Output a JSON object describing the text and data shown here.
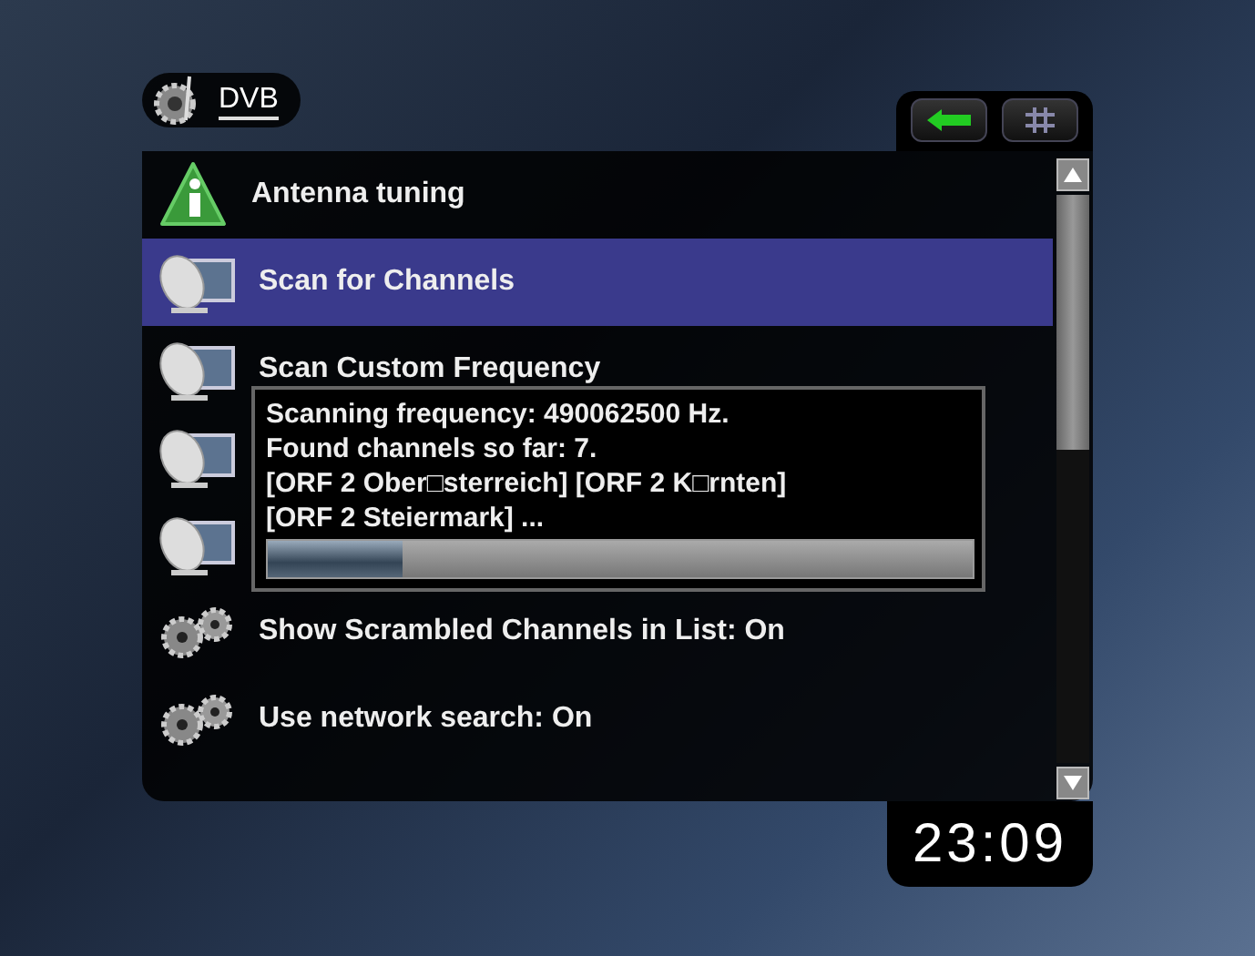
{
  "header": {
    "title": "DVB"
  },
  "menu": {
    "items": [
      {
        "kind": "info",
        "label": "Antenna tuning",
        "selected": false
      },
      {
        "kind": "dish",
        "label": "Scan for Channels",
        "selected": true
      },
      {
        "kind": "dish",
        "label": "Scan Custom Frequency",
        "selected": false
      },
      {
        "kind": "dish",
        "selected": false
      },
      {
        "kind": "dish",
        "selected": false
      },
      {
        "kind": "gears",
        "label": "Show Scrambled Channels in List: On",
        "selected": false
      },
      {
        "kind": "gears",
        "label": "Use network search: On",
        "selected": false
      }
    ]
  },
  "scan_dialog": {
    "lines": [
      "Scanning frequency: 490062500 Hz.",
      "Found channels so far: 7.",
      "[ORF 2 Ober□sterreich] [ORF 2 K□rnten]",
      "[ORF 2 Steiermark] ..."
    ],
    "level": 0.19
  },
  "clock": "23:09"
}
